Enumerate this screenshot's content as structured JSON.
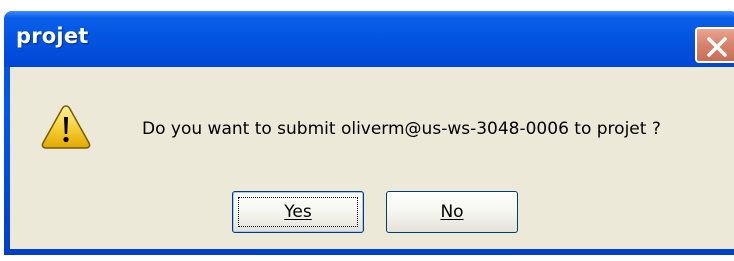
{
  "window": {
    "title": "projet",
    "title_bar_color": "#0054e3",
    "close_icon": "close-icon"
  },
  "dialog": {
    "icon": "warning-icon",
    "message": "Do you want to submit oliverm@us-ws-3048-0006 to projet ?"
  },
  "buttons": {
    "yes_label": "Yes",
    "no_label": "No",
    "default": "Yes"
  },
  "colors": {
    "face": "#ece9d8",
    "warning_fill": "#f4c430",
    "close_button": "#d8826a"
  }
}
